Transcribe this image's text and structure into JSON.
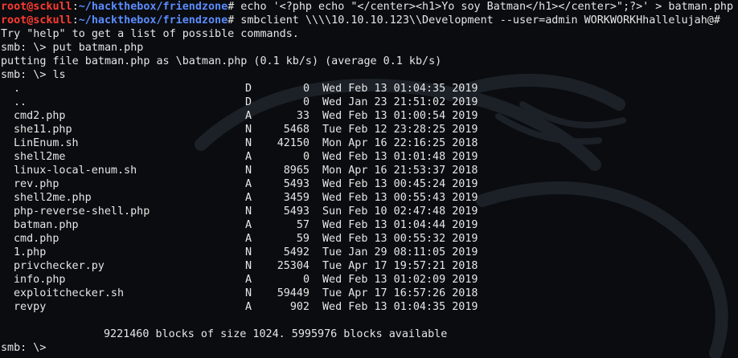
{
  "prompt": {
    "user_host": "root@sckull",
    "colon": ":",
    "path": "~/hackthebox/friendzone",
    "symbol": "#"
  },
  "lines": {
    "cmd1": " echo '<?php echo \"</center><h1>Yo soy Batman</h1></center>\";?>' > batman.php",
    "cmd2": " smbclient \\\\\\\\10.10.10.123\\\\Development --user=admin WORKWORKHhallelujah@#",
    "help": "Try \"help\" to get a list of possible commands.",
    "smb_put": "smb: \\> put batman.php",
    "putting": "putting file batman.php as \\batman.php (0.1 kb/s) (average 0.1 kb/s)",
    "smb_ls": "smb: \\> ls",
    "summary": "9221460 blocks of size 1024. 5995976 blocks available",
    "smb_final": "smb: \\>"
  },
  "listing": [
    {
      "name": ".",
      "attr": "D",
      "size": "0",
      "date": "Wed Feb 13 01:04:35 2019"
    },
    {
      "name": "..",
      "attr": "D",
      "size": "0",
      "date": "Wed Jan 23 21:51:02 2019"
    },
    {
      "name": "cmd2.php",
      "attr": "A",
      "size": "33",
      "date": "Wed Feb 13 01:00:54 2019"
    },
    {
      "name": "she11.php",
      "attr": "N",
      "size": "5468",
      "date": "Tue Feb 12 23:28:25 2019"
    },
    {
      "name": "LinEnum.sh",
      "attr": "N",
      "size": "42150",
      "date": "Mon Apr 16 22:16:25 2018"
    },
    {
      "name": "shell2me",
      "attr": "A",
      "size": "0",
      "date": "Wed Feb 13 01:01:48 2019"
    },
    {
      "name": "linux-local-enum.sh",
      "attr": "N",
      "size": "8965",
      "date": "Mon Apr 16 21:53:37 2018"
    },
    {
      "name": "rev.php",
      "attr": "A",
      "size": "5493",
      "date": "Wed Feb 13 00:45:24 2019"
    },
    {
      "name": "shell2me.php",
      "attr": "A",
      "size": "3459",
      "date": "Wed Feb 13 00:55:43 2019"
    },
    {
      "name": "php-reverse-shell.php",
      "attr": "N",
      "size": "5493",
      "date": "Sun Feb 10 02:47:48 2019"
    },
    {
      "name": "batman.php",
      "attr": "A",
      "size": "57",
      "date": "Wed Feb 13 01:04:44 2019"
    },
    {
      "name": "cmd.php",
      "attr": "A",
      "size": "59",
      "date": "Wed Feb 13 00:55:32 2019"
    },
    {
      "name": "1.php",
      "attr": "N",
      "size": "5492",
      "date": "Tue Jan 29 08:11:05 2019"
    },
    {
      "name": "privchecker.py",
      "attr": "N",
      "size": "25304",
      "date": "Tue Apr 17 19:57:21 2018"
    },
    {
      "name": "info.php",
      "attr": "A",
      "size": "0",
      "date": "Wed Feb 13 01:02:09 2019"
    },
    {
      "name": "exploitchecker.sh",
      "attr": "N",
      "size": "59449",
      "date": "Tue Apr 17 16:57:26 2018"
    },
    {
      "name": "revpy",
      "attr": "A",
      "size": "902",
      "date": "Wed Feb 13 01:04:35 2019"
    }
  ],
  "background": {
    "icon": "kali-dragon-icon",
    "color": "#1c2128"
  }
}
